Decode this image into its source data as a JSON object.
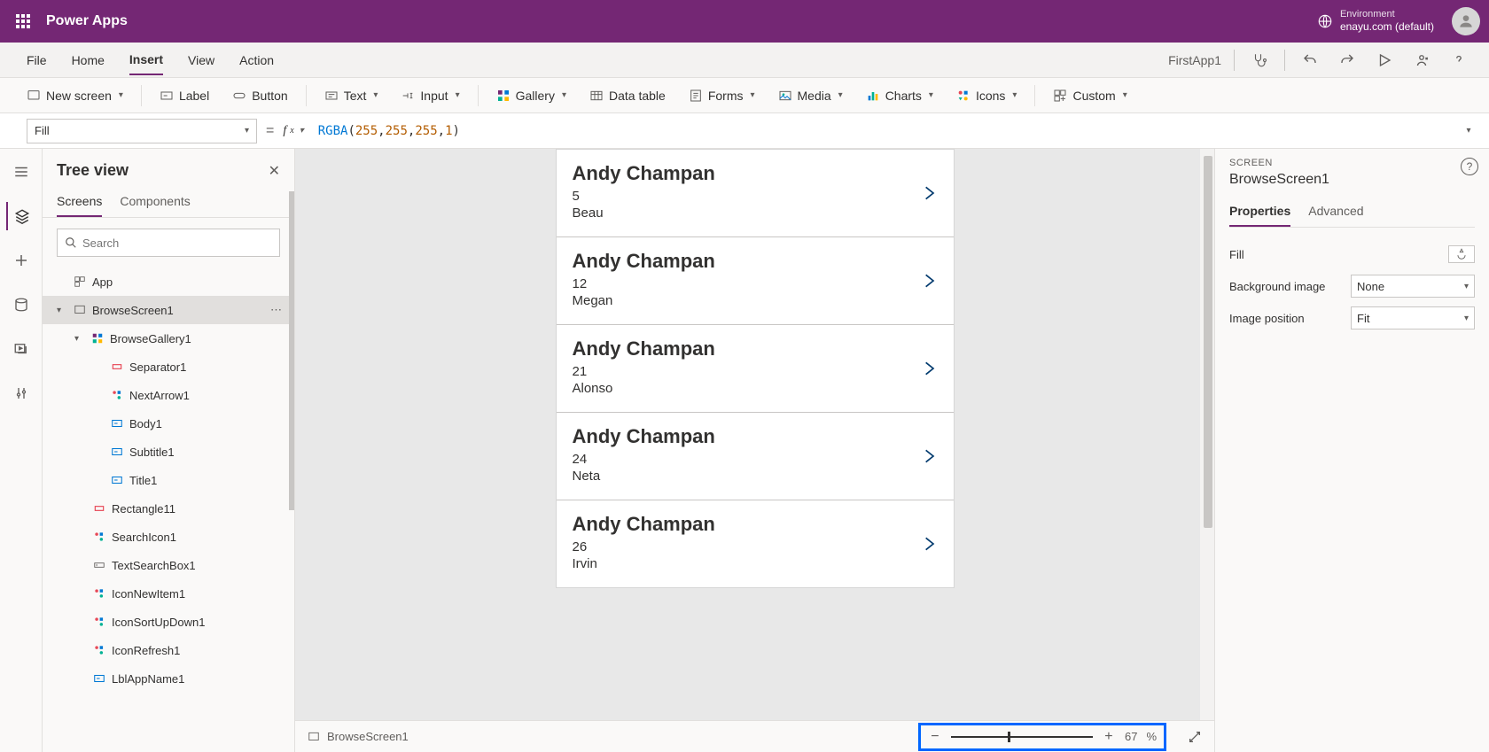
{
  "header": {
    "app_title": "Power Apps",
    "env_label": "Environment",
    "env_name": "enayu.com (default)"
  },
  "menu": {
    "file": "File",
    "home": "Home",
    "insert": "Insert",
    "view": "View",
    "action": "Action",
    "app_name": "FirstApp1"
  },
  "ribbon": {
    "new_screen": "New screen",
    "label": "Label",
    "button": "Button",
    "text": "Text",
    "input": "Input",
    "gallery": "Gallery",
    "data_table": "Data table",
    "forms": "Forms",
    "media": "Media",
    "charts": "Charts",
    "icons": "Icons",
    "custom": "Custom"
  },
  "formula": {
    "property": "Fill",
    "fn": "RGBA",
    "args": [
      "255",
      "255",
      "255",
      "1"
    ]
  },
  "tree": {
    "title": "Tree view",
    "tab_screens": "Screens",
    "tab_components": "Components",
    "search_placeholder": "Search",
    "nodes": {
      "app": "App",
      "browse_screen": "BrowseScreen1",
      "browse_gallery": "BrowseGallery1",
      "separator": "Separator1",
      "next_arrow": "NextArrow1",
      "body": "Body1",
      "subtitle": "Subtitle1",
      "title": "Title1",
      "rectangle": "Rectangle11",
      "search_icon": "SearchIcon1",
      "text_search": "TextSearchBox1",
      "icon_new": "IconNewItem1",
      "icon_sort": "IconSortUpDown1",
      "icon_refresh": "IconRefresh1",
      "lbl_app_name": "LblAppName1"
    }
  },
  "gallery": [
    {
      "title": "Andy Champan",
      "subtitle": "5",
      "body": "Beau"
    },
    {
      "title": "Andy Champan",
      "subtitle": "12",
      "body": "Megan"
    },
    {
      "title": "Andy Champan",
      "subtitle": "21",
      "body": "Alonso"
    },
    {
      "title": "Andy Champan",
      "subtitle": "24",
      "body": "Neta"
    },
    {
      "title": "Andy Champan",
      "subtitle": "26",
      "body": "Irvin"
    }
  ],
  "status": {
    "screen_name": "BrowseScreen1",
    "zoom_pct": "67",
    "zoom_unit": "%"
  },
  "props": {
    "label": "SCREEN",
    "name": "BrowseScreen1",
    "tab_properties": "Properties",
    "tab_advanced": "Advanced",
    "fill_label": "Fill",
    "bg_image_label": "Background image",
    "bg_image_value": "None",
    "img_pos_label": "Image position",
    "img_pos_value": "Fit"
  }
}
